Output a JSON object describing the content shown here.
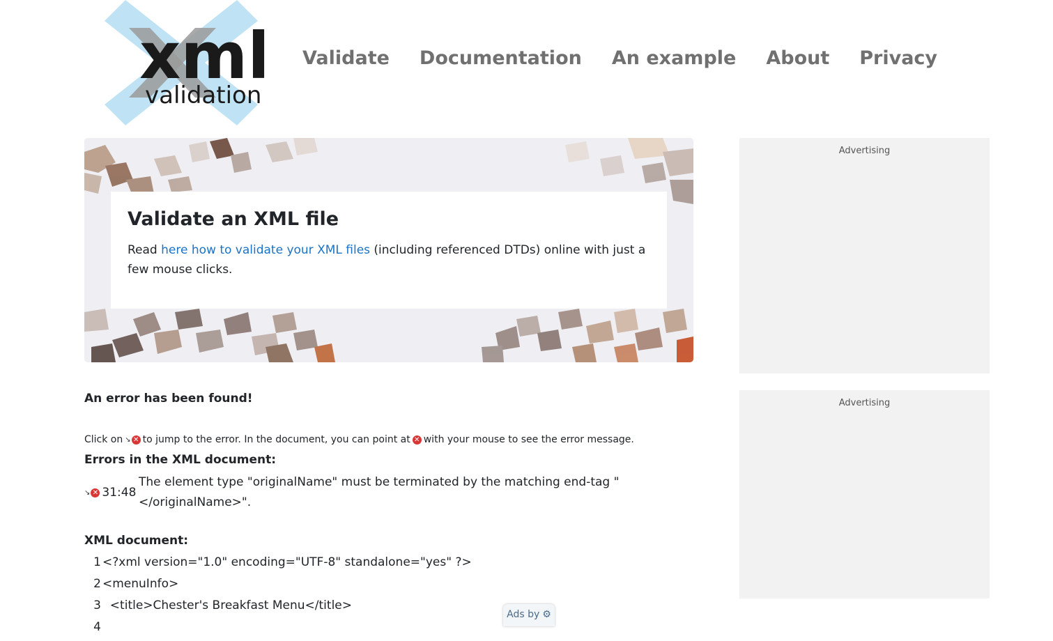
{
  "logo": {
    "word": "xml",
    "sub": "validation"
  },
  "nav": [
    {
      "label": "Validate"
    },
    {
      "label": "Documentation"
    },
    {
      "label": "An example"
    },
    {
      "label": "About"
    },
    {
      "label": "Privacy"
    }
  ],
  "hero": {
    "title": "Validate an XML file",
    "text_before": "Read ",
    "link": "here how to validate your XML files",
    "text_after": " (including referenced DTDs) online with just a few mouse clicks."
  },
  "ads": {
    "label_top": "Advertising",
    "label_bottom": "Advertising",
    "ads_by": "Ads by"
  },
  "result": {
    "error_found": "An error has been found!",
    "hint_1": "Click on",
    "hint_2": "to jump to the error. In the document, you can point at",
    "hint_3": "with your mouse to see the error message.",
    "errors_title": "Errors in the XML document:",
    "errors": [
      {
        "location": "31:48",
        "message": "The element type \"originalName\" must be terminated by the matching end-tag \"</originalName>\"."
      }
    ],
    "doc_title": "XML document:",
    "lines": [
      {
        "n": "1",
        "code": "<?xml version=\"1.0\" encoding=\"UTF-8\" standalone=\"yes\" ?>"
      },
      {
        "n": "2",
        "code": "<menuInfo>"
      },
      {
        "n": "3",
        "code": "  <title>Chester's Breakfast Menu</title>"
      },
      {
        "n": "4",
        "code": ""
      }
    ]
  },
  "colors": {
    "nav": "#707070",
    "link": "#1a73c9",
    "error_icon": "#d93636",
    "ad_bg": "#f2f2f2"
  }
}
